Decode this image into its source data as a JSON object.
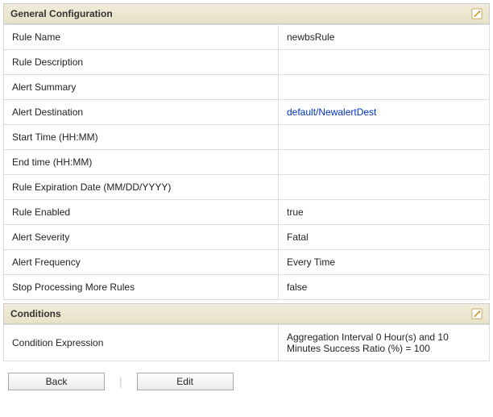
{
  "general": {
    "title": "General Configuration",
    "rows": [
      {
        "label": "Rule Name",
        "value": "newbsRule",
        "link": false
      },
      {
        "label": "Rule Description",
        "value": "",
        "link": false
      },
      {
        "label": "Alert Summary",
        "value": "",
        "link": false
      },
      {
        "label": "Alert Destination",
        "value": "default/NewalertDest",
        "link": true
      },
      {
        "label": "Start Time (HH:MM)",
        "value": "",
        "link": false
      },
      {
        "label": "End time (HH:MM)",
        "value": "",
        "link": false
      },
      {
        "label": "Rule Expiration Date (MM/DD/YYYY)",
        "value": "",
        "link": false
      },
      {
        "label": "Rule Enabled",
        "value": "true",
        "link": false
      },
      {
        "label": "Alert Severity",
        "value": "Fatal",
        "link": false
      },
      {
        "label": "Alert Frequency",
        "value": "Every Time",
        "link": false
      },
      {
        "label": "Stop Processing More Rules",
        "value": "false",
        "link": false
      }
    ]
  },
  "conditions": {
    "title": "Conditions",
    "rows": [
      {
        "label": "Condition Expression",
        "value": "Aggregation Interval 0 Hour(s) and 10 Minutes Success Ratio (%) = 100"
      }
    ]
  },
  "buttons": {
    "back": "Back",
    "edit": "Edit"
  }
}
